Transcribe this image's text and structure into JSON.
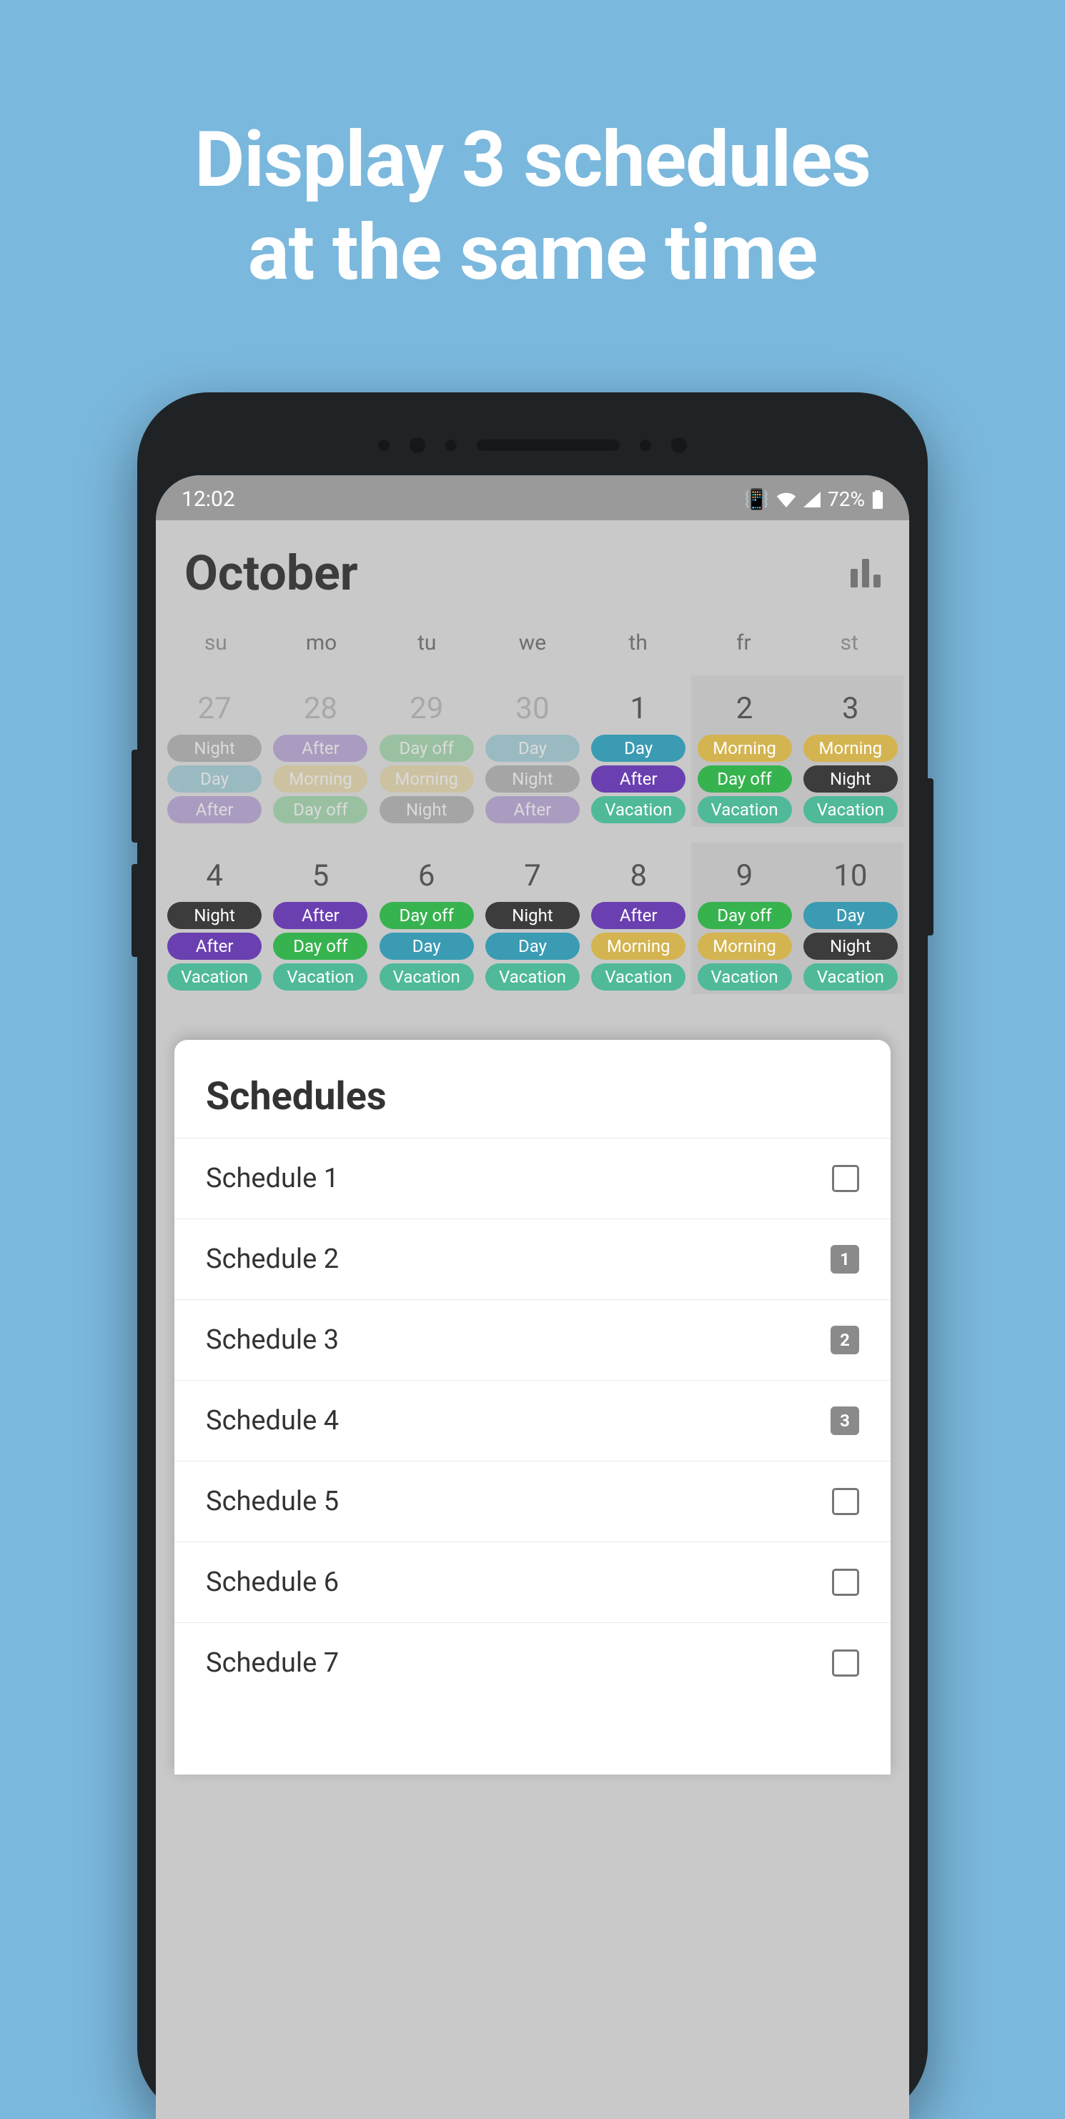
{
  "headline_line1": "Display 3 schedules",
  "headline_line2": "at the same time",
  "status": {
    "time": "12:02",
    "battery": "72%"
  },
  "app": {
    "title": "October"
  },
  "weekdays": [
    "su",
    "mo",
    "tu",
    "we",
    "th",
    "fr",
    "st"
  ],
  "week1": [
    {
      "num": "27",
      "dim": true,
      "pills": [
        [
          "Night",
          "#5a5a5a"
        ],
        [
          "Day",
          "#3a9bb3"
        ],
        [
          "After",
          "#6a3fb0"
        ]
      ]
    },
    {
      "num": "28",
      "dim": true,
      "pills": [
        [
          "After",
          "#6a3fb0"
        ],
        [
          "Morning",
          "#d4b450"
        ],
        [
          "Day off",
          "#36b34f"
        ]
      ]
    },
    {
      "num": "29",
      "dim": true,
      "pills": [
        [
          "Day off",
          "#36b34f"
        ],
        [
          "Morning",
          "#d4b450"
        ],
        [
          "Night",
          "#5a5a5a"
        ]
      ]
    },
    {
      "num": "30",
      "dim": true,
      "pills": [
        [
          "Day",
          "#3a9bb3"
        ],
        [
          "Night",
          "#5a5a5a"
        ],
        [
          "After",
          "#6a3fb0"
        ]
      ]
    },
    {
      "num": "1",
      "dim": false,
      "pills": [
        [
          "Day",
          "#3a9bb3"
        ],
        [
          "After",
          "#6a3fb0"
        ],
        [
          "Vacation",
          "#4fb99a"
        ]
      ]
    },
    {
      "num": "2",
      "dim": false,
      "pills": [
        [
          "Morning",
          "#d4b450"
        ],
        [
          "Day off",
          "#36b34f"
        ],
        [
          "Vacation",
          "#4fb99a"
        ]
      ]
    },
    {
      "num": "3",
      "dim": false,
      "pills": [
        [
          "Morning",
          "#d4b450"
        ],
        [
          "Night",
          "#3c3c3c"
        ],
        [
          "Vacation",
          "#4fb99a"
        ]
      ]
    }
  ],
  "week2": [
    {
      "num": "4",
      "pills": [
        [
          "Night",
          "#3c3c3c"
        ],
        [
          "After",
          "#6a3fb0"
        ],
        [
          "Vacation",
          "#4fb99a"
        ]
      ]
    },
    {
      "num": "5",
      "pills": [
        [
          "After",
          "#6a3fb0"
        ],
        [
          "Day off",
          "#36b34f"
        ],
        [
          "Vacation",
          "#4fb99a"
        ]
      ]
    },
    {
      "num": "6",
      "pills": [
        [
          "Day off",
          "#36b34f"
        ],
        [
          "Day",
          "#3a9bb3"
        ],
        [
          "Vacation",
          "#4fb99a"
        ]
      ]
    },
    {
      "num": "7",
      "pills": [
        [
          "Night",
          "#3c3c3c"
        ],
        [
          "Day",
          "#3a9bb3"
        ],
        [
          "Vacation",
          "#4fb99a"
        ]
      ]
    },
    {
      "num": "8",
      "pills": [
        [
          "After",
          "#6a3fb0"
        ],
        [
          "Morning",
          "#d4b450"
        ],
        [
          "Vacation",
          "#4fb99a"
        ]
      ]
    },
    {
      "num": "9",
      "pills": [
        [
          "Day off",
          "#36b34f"
        ],
        [
          "Morning",
          "#d4b450"
        ],
        [
          "Vacation",
          "#4fb99a"
        ]
      ]
    },
    {
      "num": "10",
      "pills": [
        [
          "Day",
          "#3a9bb3"
        ],
        [
          "Night",
          "#3c3c3c"
        ],
        [
          "Vacation",
          "#4fb99a"
        ]
      ]
    }
  ],
  "sheet": {
    "title": "Schedules",
    "items": [
      {
        "label": "Schedule 1",
        "badge": null
      },
      {
        "label": "Schedule 2",
        "badge": "1"
      },
      {
        "label": "Schedule 3",
        "badge": "2"
      },
      {
        "label": "Schedule 4",
        "badge": "3"
      },
      {
        "label": "Schedule 5",
        "badge": null
      },
      {
        "label": "Schedule 6",
        "badge": null
      },
      {
        "label": "Schedule 7",
        "badge": null
      }
    ]
  }
}
